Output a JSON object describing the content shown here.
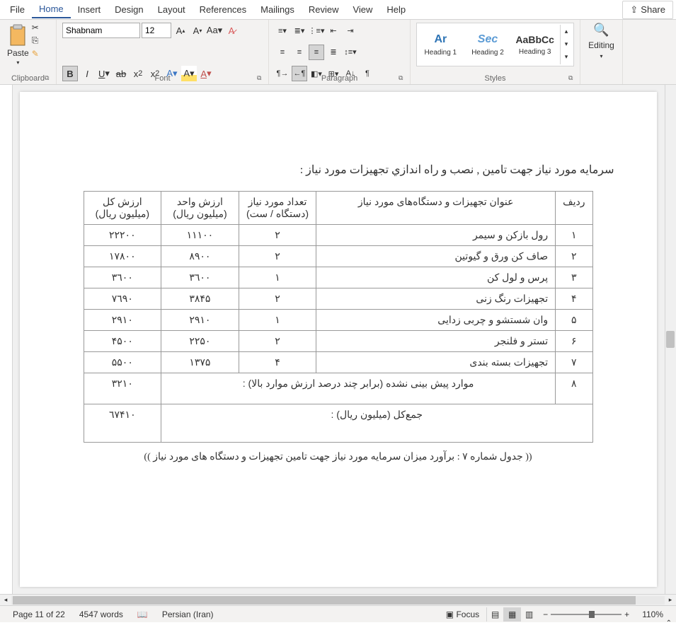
{
  "menubar": {
    "items": [
      "File",
      "Home",
      "Insert",
      "Design",
      "Layout",
      "References",
      "Mailings",
      "Review",
      "View",
      "Help"
    ],
    "active": "Home",
    "share": "Share"
  },
  "ribbon": {
    "clipboard": {
      "paste": "Paste",
      "label": "Clipboard"
    },
    "font": {
      "name": "Shabnam",
      "size": "12",
      "label": "Font"
    },
    "paragraph": {
      "label": "Paragraph"
    },
    "styles": {
      "items": [
        {
          "preview": "Ar",
          "name": "Heading 1",
          "cls": ""
        },
        {
          "preview": "Sec",
          "name": "Heading 2",
          "cls": "h2"
        },
        {
          "preview": "AaBbCc",
          "name": "Heading 3",
          "cls": "normal"
        }
      ],
      "label": "Styles"
    },
    "editing": {
      "label": "Editing"
    }
  },
  "document": {
    "title": "سرمایه مورد نیاز جهت تامین , نصب و راه اندازي تجهیزات مورد نیاز :",
    "headers": {
      "row": "ردیف",
      "name": "عنوان تجهیزات و دستگاه‌های مورد نیاز",
      "qty": "تعداد مورد نیاز (دستگاه / ست)",
      "unit": "ارزش واحد (میلیون ریال)",
      "total": "ارزش کل (میلیون ریال)"
    },
    "rows": [
      {
        "n": "١",
        "name": "رول بازکن و سیمر",
        "qty": "٢",
        "unit": "١١١٠٠",
        "total": "٢٢٢٠٠"
      },
      {
        "n": "٢",
        "name": "صاف کن ورق و گیوتین",
        "qty": "٢",
        "unit": "٨٩٠٠",
        "total": "١٧٨٠٠"
      },
      {
        "n": "٣",
        "name": "پرس و لول کن",
        "qty": "١",
        "unit": "٣٦٠٠",
        "total": "٣٦٠٠"
      },
      {
        "n": "۴",
        "name": "تجهیزات رنگ زنی",
        "qty": "٢",
        "unit": "٣٨۴۵",
        "total": "٧٦٩٠"
      },
      {
        "n": "۵",
        "name": "وان شستشو و چربی زدایی",
        "qty": "١",
        "unit": "٢٩١٠",
        "total": "٢٩١٠"
      },
      {
        "n": "۶",
        "name": "تستر و فلنجر",
        "qty": "٢",
        "unit": "٢٢۵٠",
        "total": "۴۵٠٠"
      },
      {
        "n": "٧",
        "name": "تجهیزات بسته بندی",
        "qty": "۴",
        "unit": "١٣٧۵",
        "total": "۵۵٠٠"
      }
    ],
    "unforeseen": {
      "n": "٨",
      "name": "موارد پیش بینی نشده (برابر چند درصد ارزش موارد بالا) :",
      "total": "٣٢١٠"
    },
    "sum": {
      "label": "جمع‌کل (میلیون ریال) :",
      "total": "٦٧۴١٠"
    },
    "caption": "(( جدول شماره ٧ : برآورد میزان سرمایه مورد نیاز جهت تامین تجهیزات و دستگاه های مورد نیاز ))"
  },
  "statusbar": {
    "page": "Page 11 of 22",
    "words": "4547 words",
    "lang": "Persian (Iran)",
    "focus": "Focus",
    "zoom": "110%"
  }
}
